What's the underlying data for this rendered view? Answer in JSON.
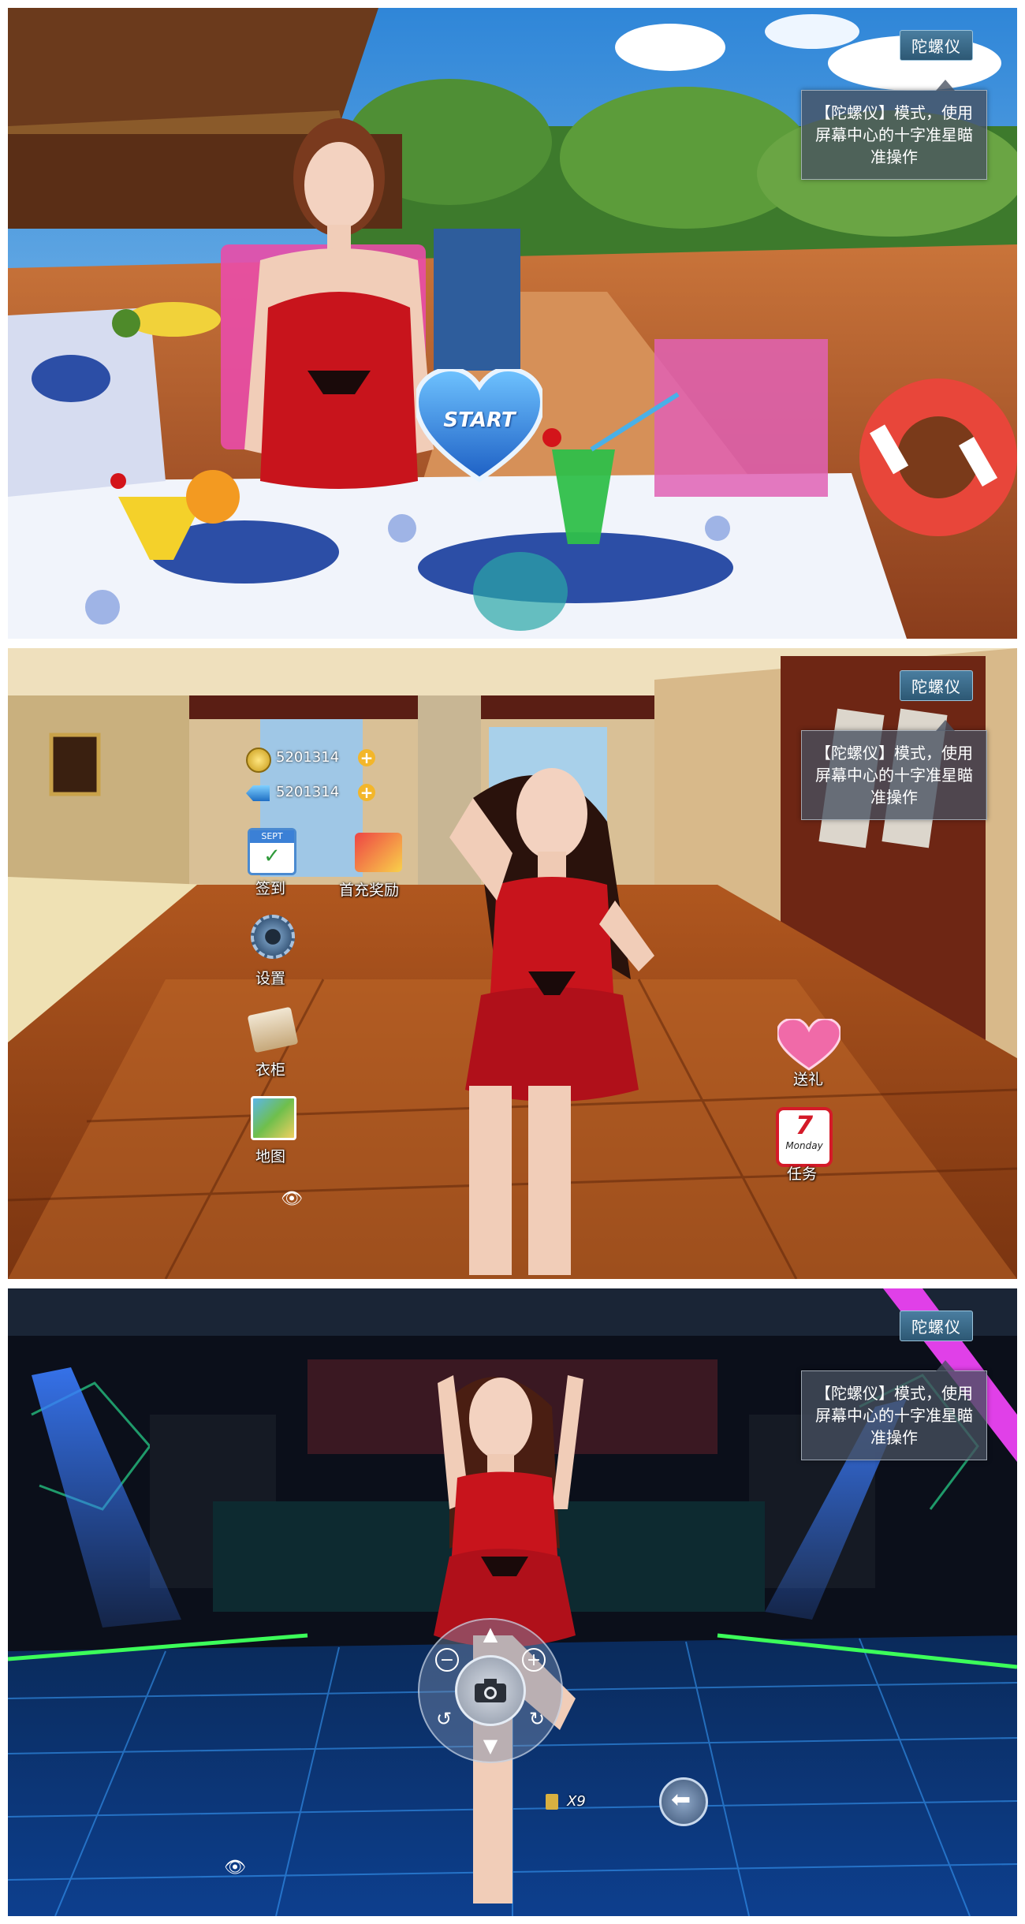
{
  "gyro": {
    "tag": "陀螺仪",
    "tip": "【陀螺仪】模式，使用屏幕中心的十字准星瞄准操作"
  },
  "screen1": {
    "start_button": "START"
  },
  "screen2": {
    "currency": [
      {
        "icon": "gold-coin-icon",
        "value": "5201314"
      },
      {
        "icon": "blue-gem-icon",
        "value": "5201314"
      }
    ],
    "menu": {
      "checkin": {
        "label": "签到",
        "badge": "SEPT"
      },
      "first_recharge": "首充奖励",
      "settings": "设置",
      "wardrobe": "衣柜",
      "map": "地图",
      "gift": "送礼",
      "tasks": {
        "label": "任务",
        "day_number": "7",
        "day_name": "Monday"
      }
    }
  },
  "screen3": {
    "multiplier": "X9"
  },
  "colors": {
    "accent_blue": "#2a7fd6",
    "dress_red": "#c8141c"
  }
}
